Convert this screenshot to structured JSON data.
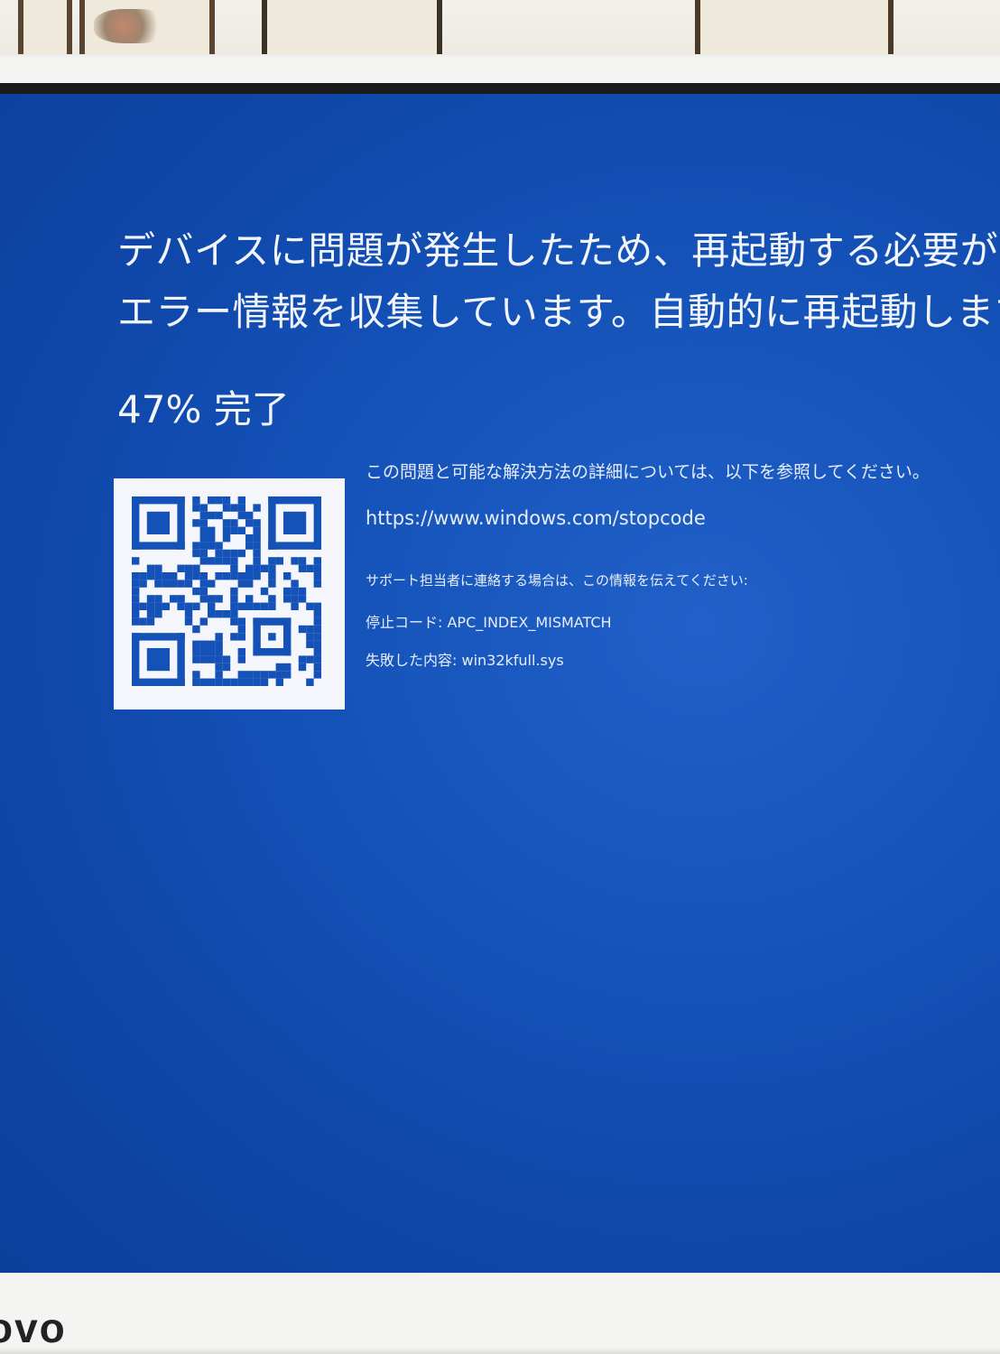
{
  "error_screen": {
    "headline_line1": "デバイスに問題が発生したため、再起動する必要があ",
    "headline_line2": "エラー情報を収集しています。自動的に再起動します",
    "progress_text": "47% 完了",
    "details_text": "この問題と可能な解決方法の詳細については、以下を参照してください。",
    "url": "https://www.windows.com/stopcode",
    "support_text": "サポート担当者に連絡する場合は、この情報を伝えてください:",
    "stop_code_line": "停止コード: APC_INDEX_MISMATCH",
    "failed_line": "失敗した内容: win32kfull.sys"
  },
  "monitor": {
    "brand_partial": "ovo"
  },
  "colors": {
    "screen_blue": "#1452b8",
    "text": "#f2f5fb",
    "qr_module": "#1452b8",
    "qr_background": "#f4f6fb"
  },
  "icons": {
    "qr_code": "qr-code-icon"
  }
}
